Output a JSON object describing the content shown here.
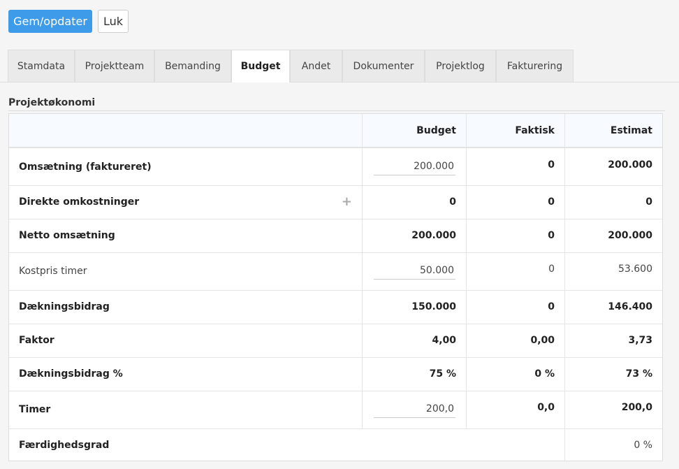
{
  "toolbar": {
    "save_label": "Gem/opdater",
    "close_label": "Luk"
  },
  "tabs": [
    {
      "label": "Stamdata"
    },
    {
      "label": "Projektteam"
    },
    {
      "label": "Bemanding"
    },
    {
      "label": "Budget"
    },
    {
      "label": "Andet"
    },
    {
      "label": "Dokumenter"
    },
    {
      "label": "Projektlog"
    },
    {
      "label": "Fakturering"
    }
  ],
  "active_tab": "Budget",
  "section": {
    "title": "Projektøkonomi"
  },
  "table": {
    "headers": {
      "budget": "Budget",
      "faktisk": "Faktisk",
      "estimat": "Estimat"
    },
    "rows": [
      {
        "label": "Omsætning (faktureret)",
        "budget": "200.000",
        "faktisk": "0",
        "estimat": "200.000"
      },
      {
        "label": "Direkte omkostninger",
        "action": "+",
        "budget": "0",
        "faktisk": "0",
        "estimat": "0"
      },
      {
        "label": "Netto omsætning",
        "budget": "200.000",
        "faktisk": "0",
        "estimat": "200.000"
      },
      {
        "label": "Kostpris timer",
        "budget": "50.000",
        "faktisk": "0",
        "estimat": "53.600"
      },
      {
        "label": "Dækningsbidrag",
        "budget": "150.000",
        "faktisk": "0",
        "estimat": "146.400"
      },
      {
        "label": "Faktor",
        "budget": "4,00",
        "faktisk": "0,00",
        "estimat": "3,73"
      },
      {
        "label": "Dækningsbidrag %",
        "budget": "75 %",
        "faktisk": "0 %",
        "estimat": "73 %"
      },
      {
        "label": "Timer",
        "budget": "200,0",
        "faktisk": "0,0",
        "estimat": "200,0"
      },
      {
        "label": "Færdighedsgrad",
        "estimat": "0 %"
      }
    ]
  },
  "colors": {
    "primary": "#3d9be9",
    "header_bg": "#f7fafe",
    "page_bg": "#f5f5f5"
  }
}
